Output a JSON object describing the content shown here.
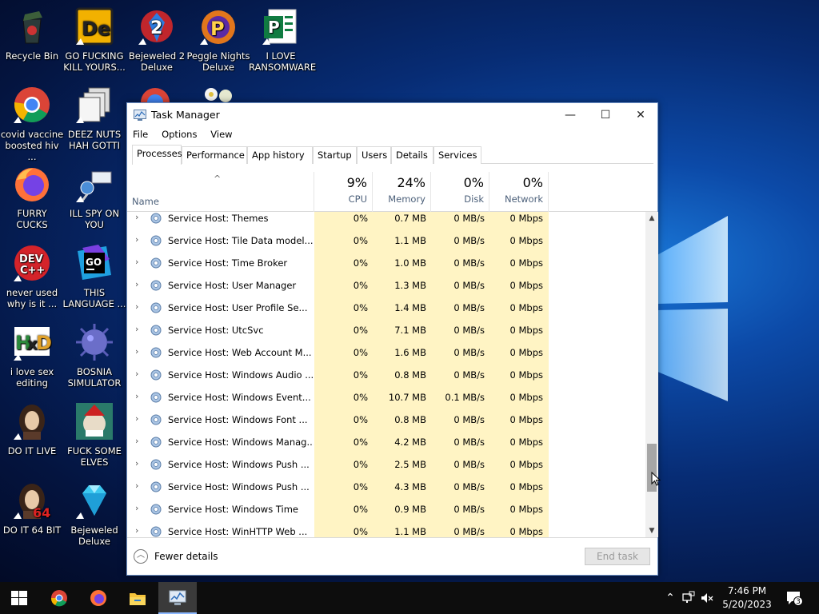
{
  "desktop": {
    "icons": [
      {
        "label": "Recycle Bin",
        "icon": "recycle-bin-icon"
      },
      {
        "label": "GO FUCKING\nKILL YOURS...",
        "icon": "de-app-icon"
      },
      {
        "label": "Bejeweled 2\nDeluxe",
        "icon": "bejeweled2-icon"
      },
      {
        "label": "Peggle Nights\nDeluxe",
        "icon": "peggle-icon"
      },
      {
        "label": "I LOVE\nRANSOMWARE",
        "icon": "publisher-icon"
      },
      {
        "label": "covid vaccine\nboosted hiv ...",
        "icon": "chrome-icon"
      },
      {
        "label": "DEEZ NUTS\nHAH GOTTI",
        "icon": "copy-files-icon"
      },
      {
        "label": "FURRY CUCKS",
        "icon": "firefox-icon"
      },
      {
        "label": "ILL SPY ON\nYOU",
        "icon": "network-spy-icon"
      },
      {
        "label": "never used\nwhy is it ...",
        "icon": "devcpp-icon"
      },
      {
        "label": "THIS\nLANGUAGE ...",
        "icon": "go-ide-icon"
      },
      {
        "label": "i love sex\nediting",
        "icon": "hxd-icon"
      },
      {
        "label": "BOSNIA\nSIMULATOR",
        "icon": "virus-ball-icon"
      },
      {
        "label": "DO IT LIVE",
        "icon": "portrait-icon"
      },
      {
        "label": "FUCK SOME\nELVES",
        "icon": "elf-game-icon"
      },
      {
        "label": "DO IT 64 BIT",
        "icon": "portrait-64-icon"
      },
      {
        "label": "Bejeweled\nDeluxe",
        "icon": "diamond-icon"
      }
    ]
  },
  "window": {
    "title": "Task Manager",
    "minimize": "—",
    "maximize": "☐",
    "close": "✕",
    "menu": [
      "File",
      "Options",
      "View"
    ],
    "tabs": [
      "Processes",
      "Performance",
      "App history",
      "Startup",
      "Users",
      "Details",
      "Services"
    ],
    "active_tab": "Processes"
  },
  "columns": {
    "name": "Name",
    "sort_indicator": "^",
    "cpu": {
      "pct": "9%",
      "label": "CPU"
    },
    "memory": {
      "pct": "24%",
      "label": "Memory"
    },
    "disk": {
      "pct": "0%",
      "label": "Disk"
    },
    "network": {
      "pct": "0%",
      "label": "Network"
    }
  },
  "rows": [
    {
      "name": "Service Host: Themes",
      "cpu": "0%",
      "memory": "0.7 MB",
      "disk": "0 MB/s",
      "network": "0 Mbps"
    },
    {
      "name": "Service Host: Tile Data model...",
      "cpu": "0%",
      "memory": "1.1 MB",
      "disk": "0 MB/s",
      "network": "0 Mbps"
    },
    {
      "name": "Service Host: Time Broker",
      "cpu": "0%",
      "memory": "1.0 MB",
      "disk": "0 MB/s",
      "network": "0 Mbps"
    },
    {
      "name": "Service Host: User Manager",
      "cpu": "0%",
      "memory": "1.3 MB",
      "disk": "0 MB/s",
      "network": "0 Mbps"
    },
    {
      "name": "Service Host: User Profile Se...",
      "cpu": "0%",
      "memory": "1.4 MB",
      "disk": "0 MB/s",
      "network": "0 Mbps"
    },
    {
      "name": "Service Host: UtcSvc",
      "cpu": "0%",
      "memory": "7.1 MB",
      "disk": "0 MB/s",
      "network": "0 Mbps"
    },
    {
      "name": "Service Host: Web Account M...",
      "cpu": "0%",
      "memory": "1.6 MB",
      "disk": "0 MB/s",
      "network": "0 Mbps"
    },
    {
      "name": "Service Host: Windows Audio ...",
      "cpu": "0%",
      "memory": "0.8 MB",
      "disk": "0 MB/s",
      "network": "0 Mbps"
    },
    {
      "name": "Service Host: Windows Event...",
      "cpu": "0%",
      "memory": "10.7 MB",
      "disk": "0.1 MB/s",
      "network": "0 Mbps"
    },
    {
      "name": "Service Host: Windows Font ...",
      "cpu": "0%",
      "memory": "0.8 MB",
      "disk": "0 MB/s",
      "network": "0 Mbps"
    },
    {
      "name": "Service Host: Windows Manag...",
      "cpu": "0%",
      "memory": "4.2 MB",
      "disk": "0 MB/s",
      "network": "0 Mbps"
    },
    {
      "name": "Service Host: Windows Push ...",
      "cpu": "0%",
      "memory": "2.5 MB",
      "disk": "0 MB/s",
      "network": "0 Mbps"
    },
    {
      "name": "Service Host: Windows Push ...",
      "cpu": "0%",
      "memory": "4.3 MB",
      "disk": "0 MB/s",
      "network": "0 Mbps"
    },
    {
      "name": "Service Host: Windows Time",
      "cpu": "0%",
      "memory": "0.9 MB",
      "disk": "0 MB/s",
      "network": "0 Mbps"
    },
    {
      "name": "Service Host: WinHTTP Web ...",
      "cpu": "0%",
      "memory": "1.1 MB",
      "disk": "0 MB/s",
      "network": "0 Mbps"
    }
  ],
  "footer": {
    "fewer_details": "Fewer details",
    "end_task": "End task"
  },
  "taskbar": {
    "time": "7:46 PM",
    "date": "5/20/2023",
    "notification_count": "3",
    "pinned": [
      "windows-start-icon",
      "chrome-icon",
      "firefox-icon",
      "file-explorer-icon",
      "task-manager-icon"
    ]
  },
  "colors": {
    "accent": "#0078d7",
    "heat_light": "#fff4c4",
    "heat_medium": "#f9eca8"
  }
}
